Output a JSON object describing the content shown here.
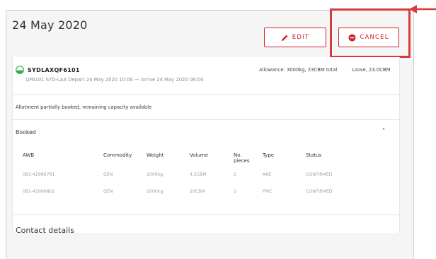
{
  "header": {
    "date": "24 May 2020",
    "edit_label": "EDIT",
    "cancel_label": "CANCEL"
  },
  "flight": {
    "code": "SYDLAXQF6101",
    "detail": "QF6101 SYD-LAX Depart 24 May 2020 10:00 — Arrive 24 May 2020 06:00",
    "allowance": "Allowance: 3000kg, 23CBM total",
    "loose": "Loose, 23.0CBM"
  },
  "notice": "Allotment partially booked, remaining capacity available",
  "booked": {
    "title": "Booked",
    "columns": [
      "AWB",
      "Commodity",
      "Weight",
      "Volume",
      "No. pieces",
      "Type",
      "Status"
    ],
    "rows": [
      [
        "081-42969791",
        "GEN",
        "1000kg",
        "4.2CBM",
        "2",
        "AKE",
        "CONFIRMED"
      ],
      [
        "081-42969802",
        "GEN",
        "1000kg",
        "10CBM",
        "1",
        "PMC",
        "CONFIRMED"
      ]
    ]
  },
  "contact": {
    "title": "Contact details"
  },
  "colors": {
    "accent": "#d2232a",
    "status_green": "#2bb24c",
    "highlight": "#d63a3a"
  }
}
